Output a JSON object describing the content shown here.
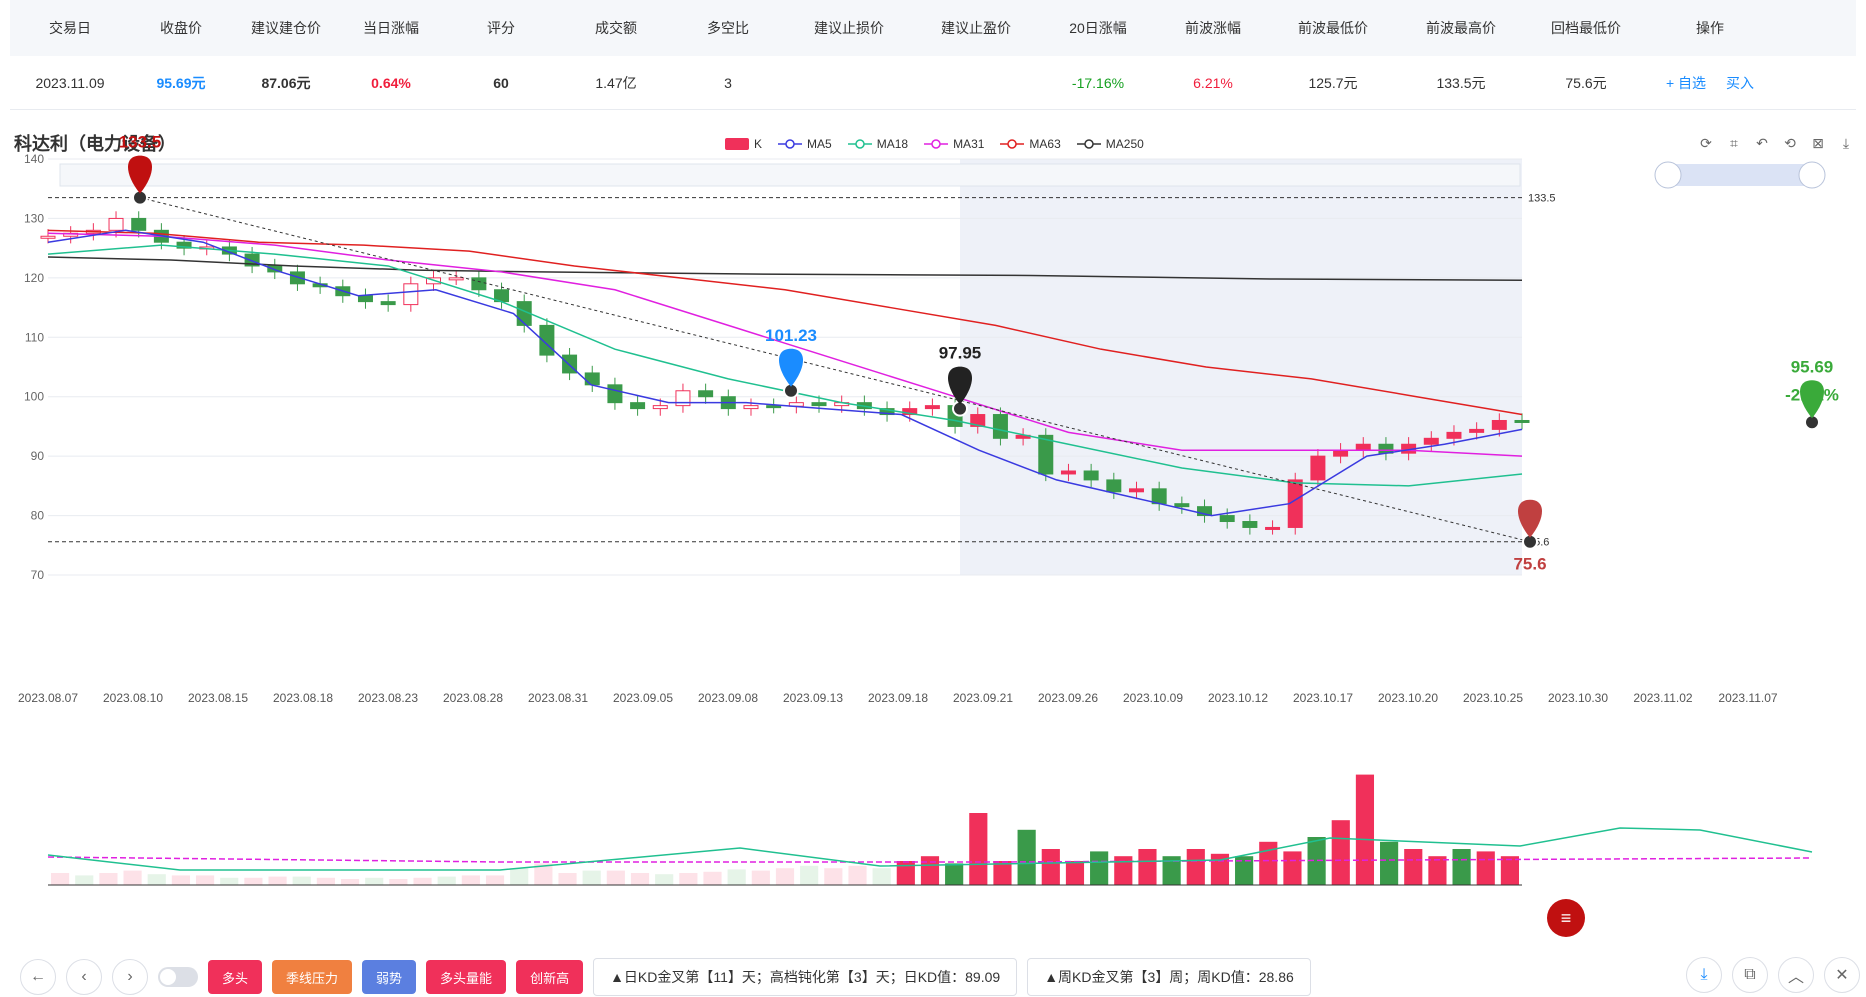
{
  "table": {
    "headers": [
      "交易日",
      "收盘价",
      "建议建仓价",
      "当日涨幅",
      "评分",
      "成交额",
      "多空比",
      "建议止损价",
      "建议止盈价",
      "20日涨幅",
      "前波涨幅",
      "前波最低价",
      "前波最高价",
      "回档最低价",
      "操作"
    ],
    "row": {
      "date": "2023.11.09",
      "close": "95.69元",
      "buy_price": "87.06元",
      "day_change": "0.64%",
      "score": "60",
      "turnover": "1.47亿",
      "ratio": "3",
      "stop_loss": "",
      "take_profit": "",
      "chg20": "-17.16%",
      "prev_wave_chg": "6.21%",
      "prev_low": "125.7元",
      "prev_high": "133.5元",
      "pullback_low": "75.6元",
      "op_watch": "+ 自选",
      "op_buy": "买入"
    }
  },
  "chart_title": "科达利（电力设备）",
  "legend": [
    "K",
    "MA5",
    "MA18",
    "MA31",
    "MA63",
    "MA250"
  ],
  "colors": {
    "up": "#f0305a",
    "down": "#3a9a4a",
    "ma5": "#3a3ae0",
    "ma18": "#20c090",
    "ma31": "#e020e0",
    "ma63": "#e02020",
    "ma250": "#333333"
  },
  "markers": {
    "high": "133.5",
    "mid": "101.23",
    "cur": "97.95",
    "low": "75.6",
    "last": "95.69",
    "last_chg": "-2.31%",
    "right_high": "133.5",
    "right_low": "75.6"
  },
  "chart_data": {
    "type": "candlestick",
    "y_ticks": [
      140,
      130,
      120,
      110,
      100,
      90,
      80,
      70
    ],
    "x_labels": [
      "2023.08.07",
      "2023.08.10",
      "2023.08.15",
      "2023.08.18",
      "2023.08.23",
      "2023.08.28",
      "2023.08.31",
      "2023.09.05",
      "2023.09.08",
      "2023.09.13",
      "2023.09.18",
      "2023.09.21",
      "2023.09.26",
      "2023.10.09",
      "2023.10.12",
      "2023.10.17",
      "2023.10.20",
      "2023.10.25",
      "2023.10.30",
      "2023.11.02",
      "2023.11.07"
    ]
  },
  "bottom": {
    "tags": [
      "多头",
      "季线压力",
      "弱势",
      "多头量能",
      "创新高"
    ],
    "tag_colors": [
      "#f0305a",
      "#f08040",
      "#5b7fe0",
      "#f0305a",
      "#f0305a"
    ],
    "info1": "▲日KD金叉第【11】天；高档钝化第【3】天；日KD值：89.09",
    "info2": "▲周KD金叉第【3】周；周KD值：28.86"
  }
}
